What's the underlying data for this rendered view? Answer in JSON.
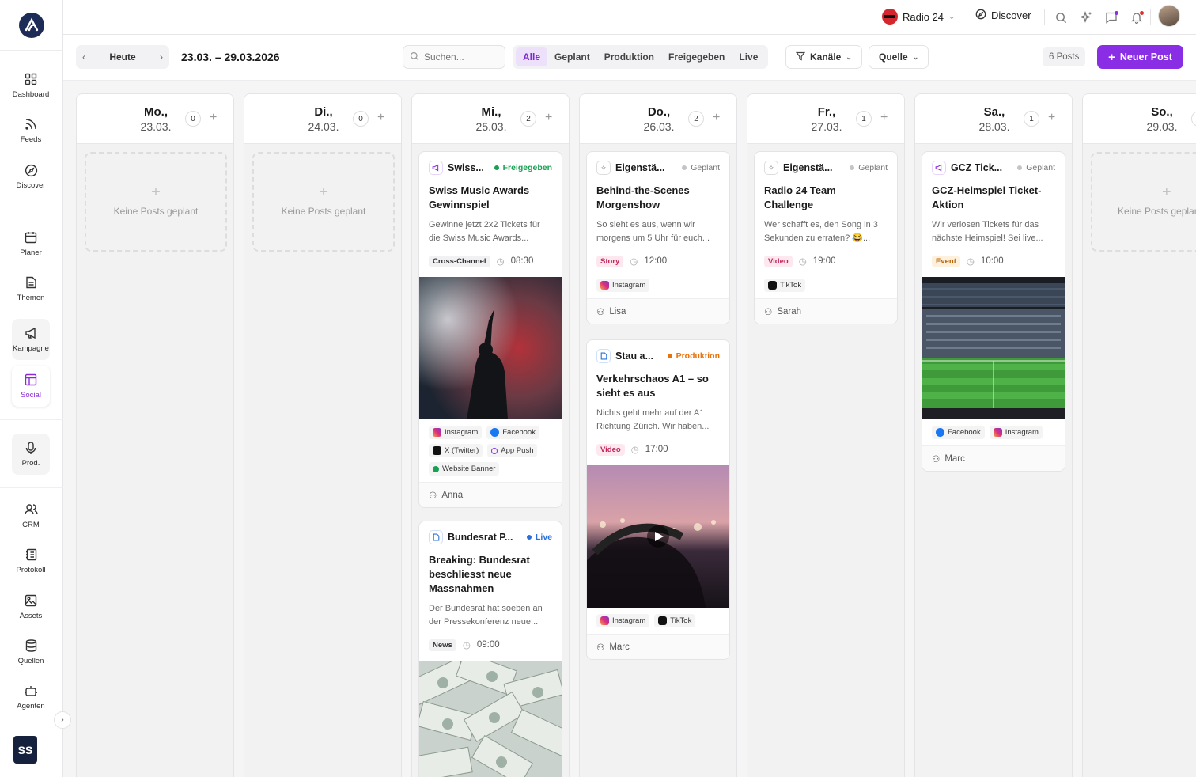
{
  "sidebar": {
    "items": [
      {
        "label": "Dashboard",
        "icon": "grid-icon"
      },
      {
        "label": "Feeds",
        "icon": "rss-icon"
      },
      {
        "label": "Discover",
        "icon": "compass-icon"
      },
      {
        "label": "Planer",
        "icon": "calendar-icon"
      },
      {
        "label": "Themen",
        "icon": "document-icon"
      },
      {
        "label": "Kampagne",
        "icon": "megaphone-icon"
      },
      {
        "label": "Social",
        "icon": "layout-icon"
      },
      {
        "label": "Prod.",
        "icon": "microphone-icon"
      },
      {
        "label": "CRM",
        "icon": "users-icon"
      },
      {
        "label": "Protokoll",
        "icon": "notebook-icon"
      },
      {
        "label": "Assets",
        "icon": "image-icon"
      },
      {
        "label": "Quellen",
        "icon": "database-icon"
      },
      {
        "label": "Agenten",
        "icon": "bot-icon"
      }
    ],
    "user_initials": "SS"
  },
  "topbar": {
    "station": "Radio 24",
    "discover": "Discover"
  },
  "toolbar": {
    "today": "Heute",
    "range": "23.03. – 29.03.2026",
    "search_placeholder": "Suchen...",
    "filters": [
      "Alle",
      "Geplant",
      "Produktion",
      "Freigegeben",
      "Live"
    ],
    "channels": "Kanäle",
    "source": "Quelle",
    "count": "6 Posts",
    "new_post": "Neuer Post"
  },
  "empty_text": "Keine Posts geplant",
  "colors": {
    "accent": "#8a2ee6",
    "freigegeben": "#1aa053",
    "geplant": "#b9b9bd",
    "produktion": "#e8730c",
    "live": "#2a6fdb"
  },
  "days": [
    {
      "name": "Mo.,",
      "date": "23.03.",
      "count": "0"
    },
    {
      "name": "Di.,",
      "date": "24.03.",
      "count": "0"
    },
    {
      "name": "Mi.,",
      "date": "25.03.",
      "count": "2"
    },
    {
      "name": "Do.,",
      "date": "26.03.",
      "count": "2"
    },
    {
      "name": "Fr.,",
      "date": "27.03.",
      "count": "1"
    },
    {
      "name": "Sa.,",
      "date": "28.03.",
      "count": "1"
    },
    {
      "name": "So.,",
      "date": "29.03.",
      "count": ""
    }
  ],
  "posts": [
    {
      "name": "Swiss...",
      "status": "Freigegeben",
      "title": "Swiss Music Awards Gewinnspiel",
      "desc": "Gewinne jetzt 2x2 Tickets für die Swiss Music Awards...",
      "tag": "Cross-Channel",
      "time": "08:30",
      "channels": [
        "Instagram",
        "Facebook",
        "X (Twitter)",
        "App Push",
        "Website Banner"
      ],
      "author": "Anna"
    },
    {
      "name": "Bundesrat P...",
      "status": "Live",
      "title": "Breaking: Bundesrat beschliesst neue Massnahmen",
      "desc": "Der Bundesrat hat soeben an der Pressekonferenz neue...",
      "tag": "News",
      "time": "09:00"
    },
    {
      "name": "Eigenstä...",
      "status": "Geplant",
      "title": "Behind-the-Scenes Morgenshow",
      "desc": "So sieht es aus, wenn wir morgens um 5 Uhr für euch...",
      "tag": "Story",
      "time": "12:00",
      "channels": [
        "Instagram"
      ],
      "author": "Lisa"
    },
    {
      "name": "Stau a...",
      "status": "Produktion",
      "title": "Verkehrschaos A1 – so sieht es aus",
      "desc": "Nichts geht mehr auf der A1 Richtung Zürich. Wir haben...",
      "tag": "Video",
      "time": "17:00",
      "channels": [
        "Instagram",
        "TikTok"
      ],
      "author": "Marc"
    },
    {
      "name": "Eigenstä...",
      "status": "Geplant",
      "title": "Radio 24 Team Challenge",
      "desc": "Wer schafft es, den Song in 3 Sekunden zu erraten? 😂...",
      "tag": "Video",
      "time": "19:00",
      "channels": [
        "TikTok"
      ],
      "author": "Sarah"
    },
    {
      "name": "GCZ Tick...",
      "status": "Geplant",
      "title": "GCZ-Heimspiel Ticket-Aktion",
      "desc": "Wir verlosen Tickets für das nächste Heimspiel! Sei live...",
      "tag": "Event",
      "time": "10:00",
      "channels": [
        "Facebook",
        "Instagram"
      ],
      "author": "Marc"
    }
  ]
}
